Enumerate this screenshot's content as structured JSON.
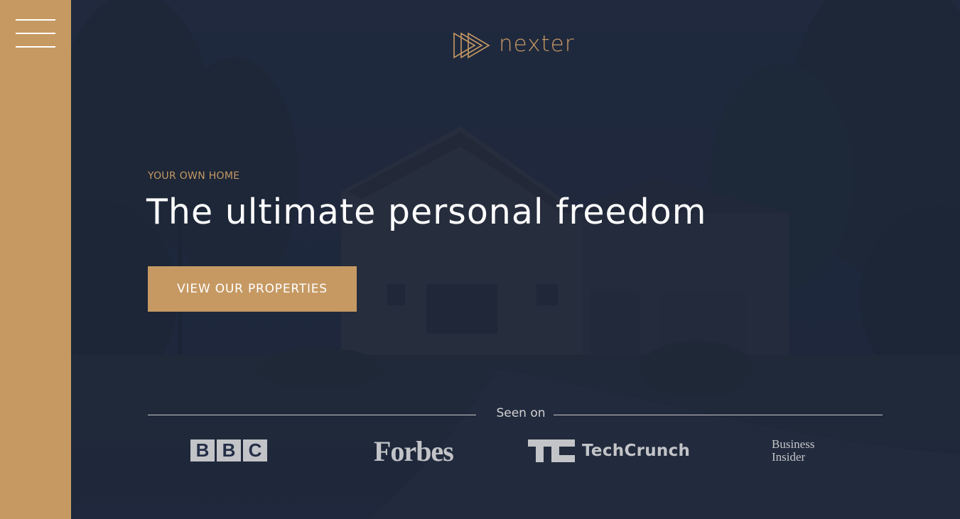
{
  "colors": {
    "accent": "#c69963",
    "overlay": "#1d263a",
    "text_light": "#ffffff",
    "muted": "#c9c9c9"
  },
  "sidebar": {
    "menu_icon": "hamburger-menu-icon"
  },
  "header": {
    "logo_icon": "play-triangles-logo-icon",
    "logo_text": "nexter"
  },
  "hero": {
    "subtitle": "YOUR OWN HOME",
    "title": "The ultimate personal freedom",
    "cta_label": "VIEW OUR PROPERTIES"
  },
  "seen_on": {
    "label": "Seen on",
    "brands": [
      {
        "name": "BBC",
        "letters": [
          "B",
          "B",
          "C"
        ]
      },
      {
        "name": "Forbes"
      },
      {
        "name": "TechCrunch",
        "icon": "techcrunch-tc-icon"
      },
      {
        "name": "Business Insider",
        "lines": [
          "Business",
          "Insider"
        ]
      }
    ]
  }
}
